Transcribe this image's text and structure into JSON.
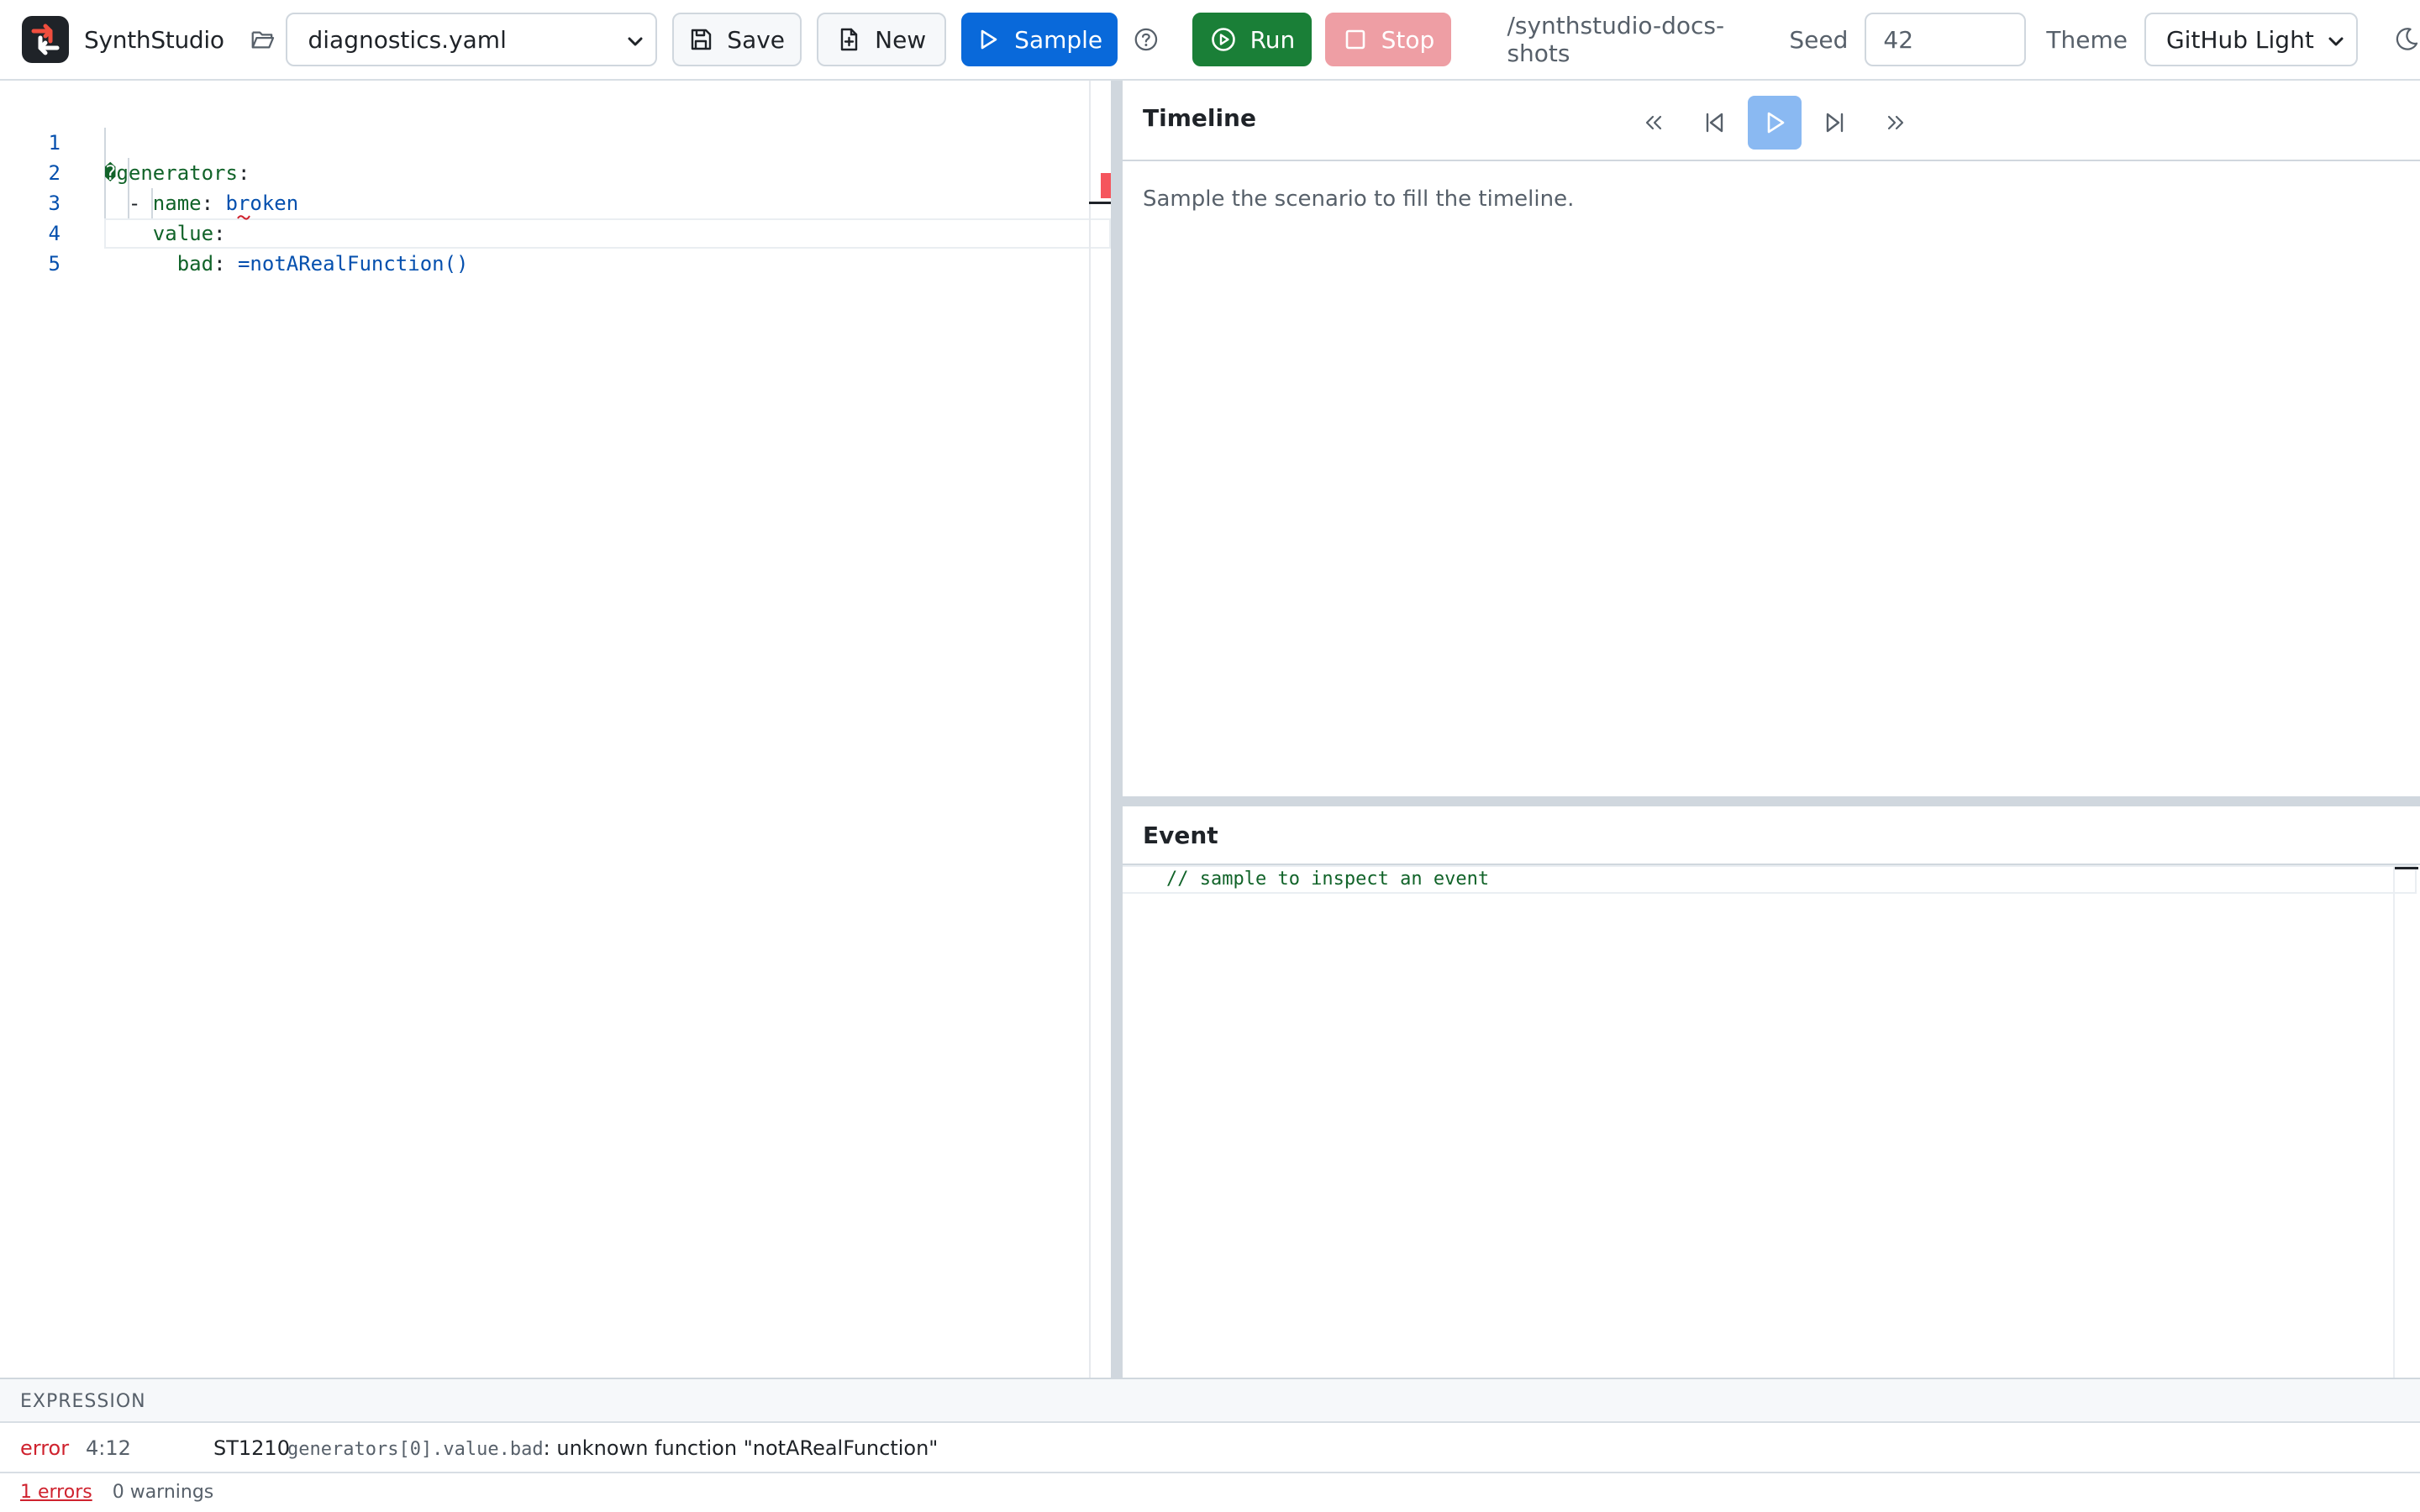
{
  "toolbar": {
    "brand": "SynthStudio",
    "file_select_value": "diagnostics.yaml",
    "save_label": "Save",
    "new_label": "New",
    "sample_label": "Sample",
    "run_label": "Run",
    "stop_label": "Stop",
    "path": "/synthstudio-docs-shots",
    "seed_label": "Seed",
    "seed_value": "42",
    "theme_label": "Theme",
    "theme_value": "GitHub Light"
  },
  "editor": {
    "lines": [
      {
        "number": "1",
        "prefix": "�",
        "key": "generators",
        "sep": ":",
        "value": ""
      },
      {
        "number": "2",
        "prefix": "  - ",
        "key": "name",
        "sep": ": ",
        "value": "broken"
      },
      {
        "number": "3",
        "prefix": "    ",
        "key": "value",
        "sep": ":",
        "value": ""
      },
      {
        "number": "4",
        "prefix": "      ",
        "key": "bad",
        "sep": ": ",
        "value": "=notARealFunction()"
      },
      {
        "number": "5",
        "prefix": "",
        "key": "",
        "sep": "",
        "value": ""
      }
    ]
  },
  "timeline": {
    "title": "Timeline",
    "empty_message": "Sample the scenario to fill the timeline."
  },
  "event": {
    "title": "Event",
    "placeholder_code": "// sample to inspect an event"
  },
  "diagnostics": {
    "title": "EXPRESSION",
    "items": [
      {
        "severity": "error",
        "position": "4:12",
        "code": "ST1210",
        "path": "generators[0].value.bad",
        "message": ": unknown function \"notARealFunction\""
      }
    ],
    "errors_summary": "1 errors",
    "warnings_summary": "0 warnings"
  },
  "colors": {
    "primary": "#0969da",
    "success": "#1a7f37",
    "danger_disabled": "#ee9ea4",
    "error": "#cf222e"
  }
}
